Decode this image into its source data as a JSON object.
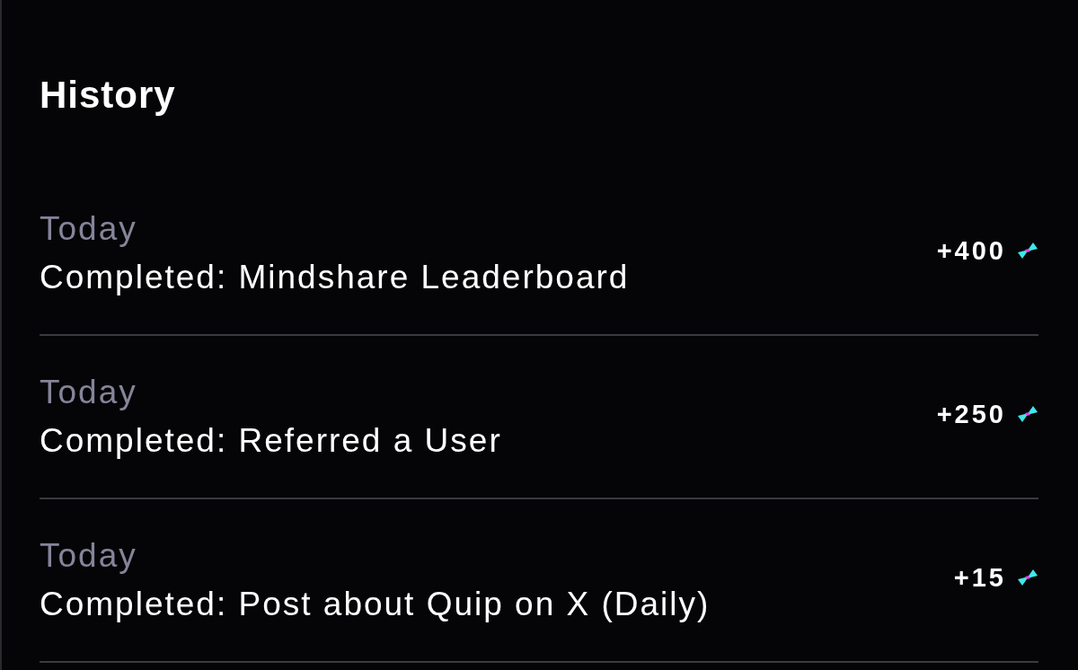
{
  "title": "History",
  "entries": [
    {
      "date": "Today",
      "description": "Completed: Mindshare Leaderboard",
      "points": "+400"
    },
    {
      "date": "Today",
      "description": "Completed: Referred a User",
      "points": "+250"
    },
    {
      "date": "Today",
      "description": "Completed: Post about Quip on X (Daily)",
      "points": "+15"
    }
  ]
}
